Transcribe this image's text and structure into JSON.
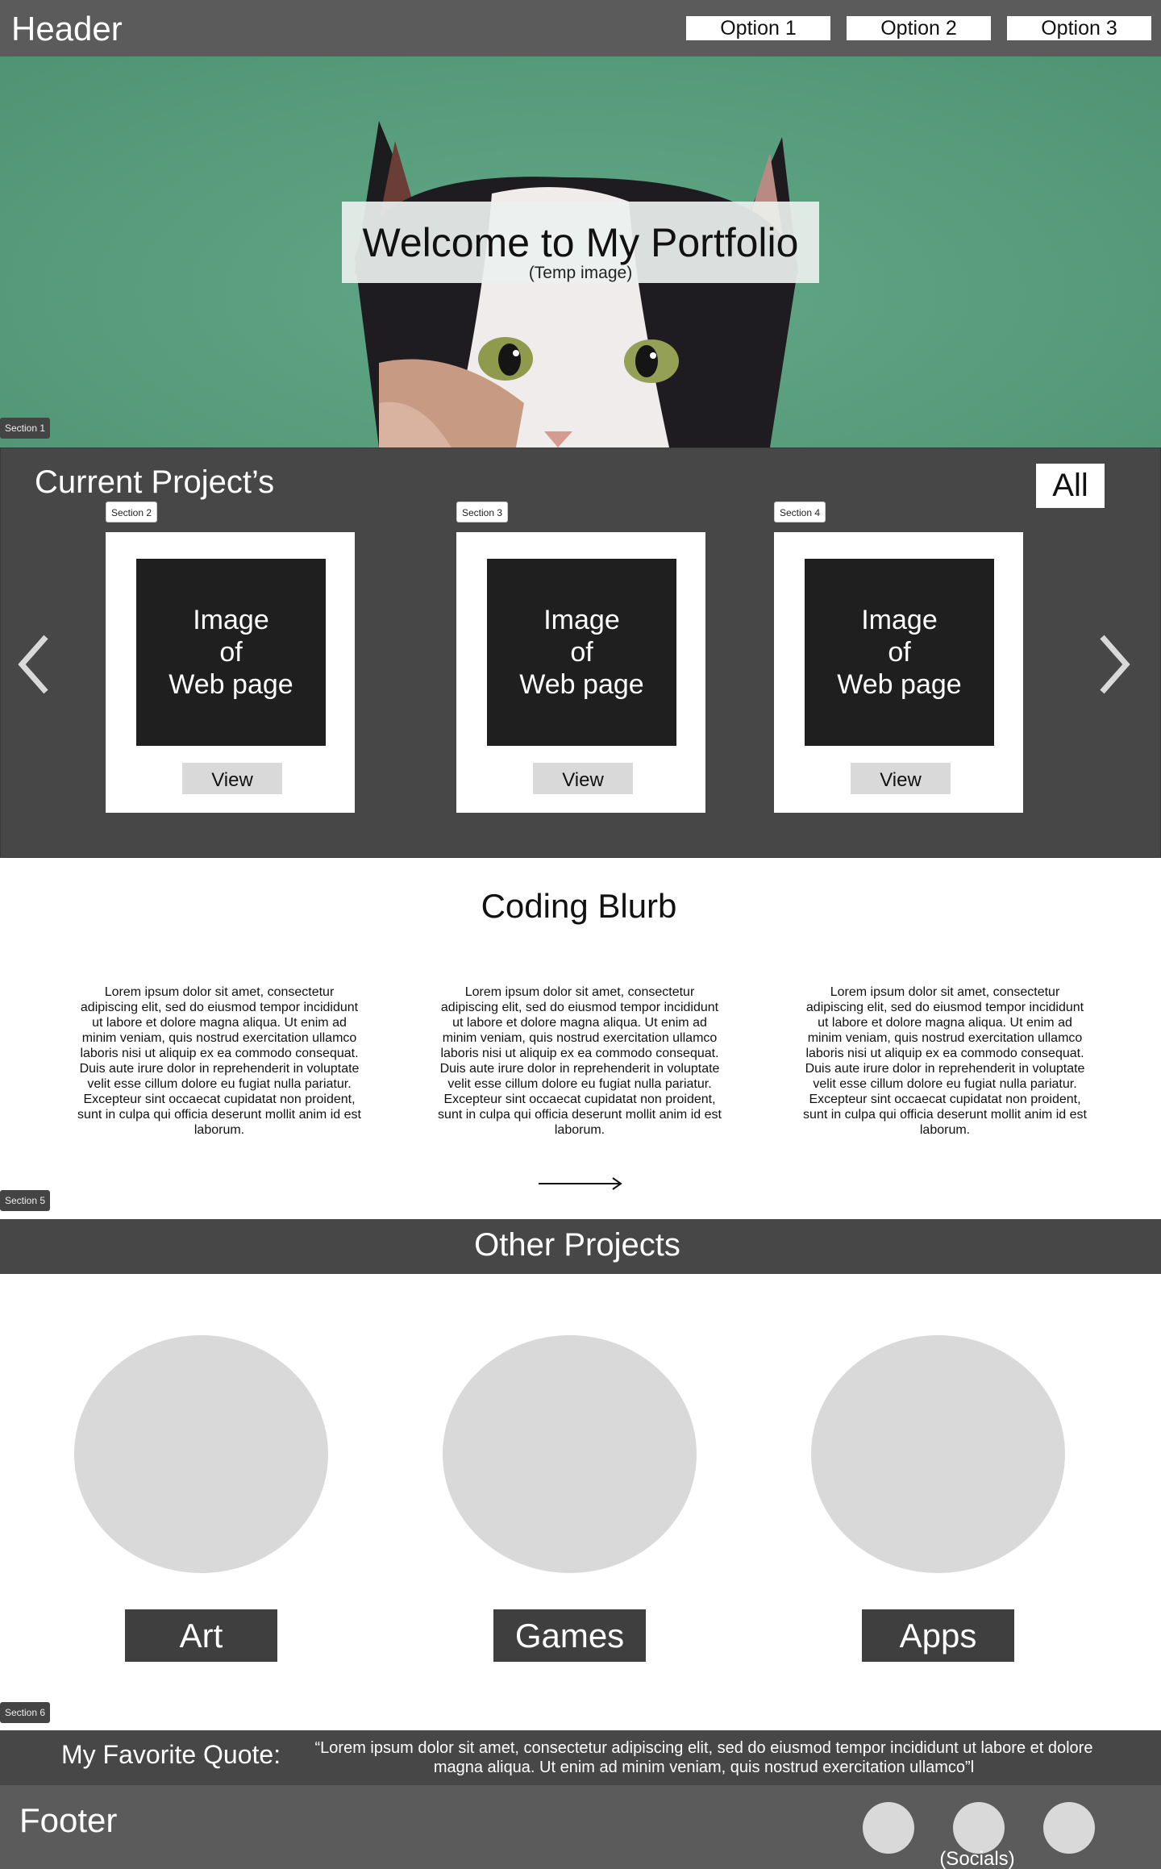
{
  "header": {
    "title": "Header",
    "nav": [
      "Option 1",
      "Option 2",
      "Option 3"
    ]
  },
  "hero": {
    "title": "Welcome to My Portfolio",
    "subtitle": "(Temp image)",
    "section_tag": "Section 1",
    "image_icon": "cat-photo"
  },
  "projects": {
    "title": "Current Project’s",
    "filter_label": "All",
    "prev_icon": "chevron-left-icon",
    "next_icon": "chevron-right-icon",
    "cards": [
      {
        "section_tag": "Section 2",
        "image_line1": "Image",
        "image_line2": "of",
        "image_line3": "Web page",
        "button": "View"
      },
      {
        "section_tag": "Section 3",
        "image_line1": "Image",
        "image_line2": "of",
        "image_line3": "Web page",
        "button": "View"
      },
      {
        "section_tag": "Section 4",
        "image_line1": "Image",
        "image_line2": "of",
        "image_line3": "Web page",
        "button": "View"
      }
    ]
  },
  "blurb": {
    "title": "Coding Blurb",
    "columns": [
      "Lorem ipsum dolor sit amet, consectetur adipiscing elit, sed do eiusmod tempor incididunt ut labore et dolore magna aliqua. Ut enim ad minim veniam, quis nostrud exercitation ullamco laboris nisi ut aliquip ex ea commodo consequat. Duis aute irure dolor in reprehenderit in voluptate velit esse cillum dolore eu fugiat nulla pariatur. Excepteur sint occaecat cupidatat non proident, sunt in culpa qui officia deserunt mollit anim id est laborum.",
      "Lorem ipsum dolor sit amet, consectetur adipiscing elit, sed do eiusmod tempor incididunt ut labore et dolore magna aliqua. Ut enim ad minim veniam, quis nostrud exercitation ullamco laboris nisi ut aliquip ex ea commodo consequat. Duis aute irure dolor in reprehenderit in voluptate velit esse cillum dolore eu fugiat nulla pariatur. Excepteur sint occaecat cupidatat non proident, sunt in culpa qui officia deserunt mollit anim id est laborum.",
      "Lorem ipsum dolor sit amet, consectetur adipiscing elit, sed do eiusmod tempor incididunt ut labore et dolore magna aliqua. Ut enim ad minim veniam, quis nostrud exercitation ullamco laboris nisi ut aliquip ex ea commodo consequat. Duis aute irure dolor in reprehenderit in voluptate velit esse cillum dolore eu fugiat nulla pariatur. Excepteur sint occaecat cupidatat non proident, sunt in culpa qui officia deserunt mollit anim id est laborum."
    ],
    "arrow_icon": "arrow-right-icon",
    "section_tag": "Section 5"
  },
  "other": {
    "title": "Other Projects",
    "items": [
      "Art",
      "Games",
      "Apps"
    ],
    "section_tag": "Section 6"
  },
  "quote": {
    "label": "My Favorite Quote:",
    "text": "“Lorem ipsum dolor sit amet, consectetur adipiscing elit, sed do eiusmod tempor incididunt ut labore et dolore magna aliqua. Ut enim ad minim veniam, quis nostrud exercitation ullamco”l"
  },
  "footer": {
    "title": "Footer",
    "socials_label": "(Socials)",
    "social_icons": [
      "social-icon",
      "social-icon",
      "social-icon"
    ]
  },
  "colors": {
    "header_bg": "#5b5b5b",
    "section_bg": "#474747",
    "hero_bg": "#5aa07f",
    "placeholder": "#d9d9d9"
  }
}
